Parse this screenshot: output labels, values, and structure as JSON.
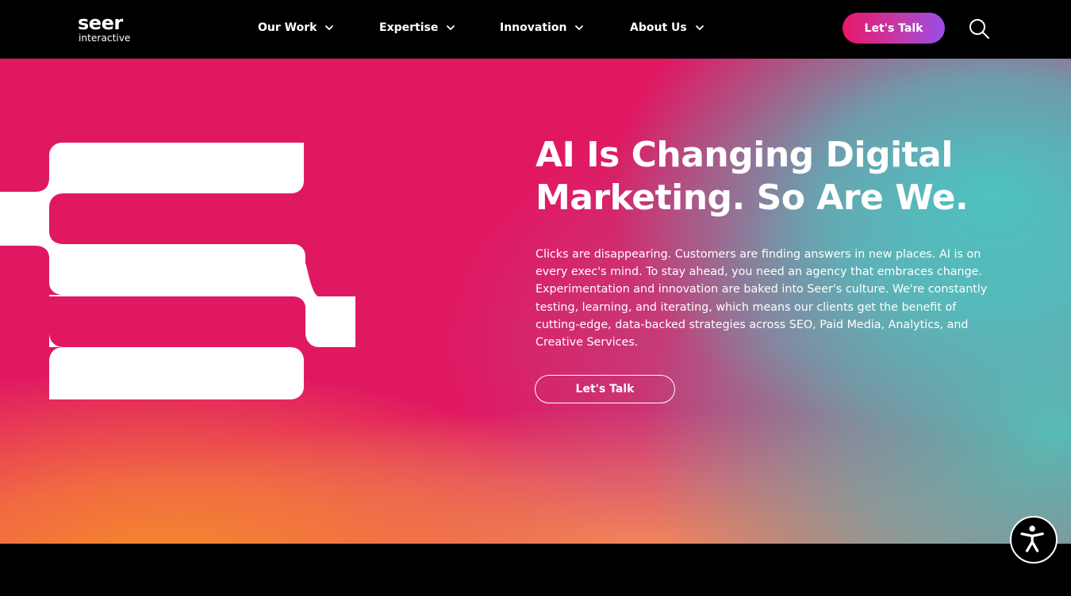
{
  "brand": {
    "wordmark": "seer",
    "subtitle": "interactive"
  },
  "nav": {
    "items": [
      {
        "label": "Our Work",
        "icon": "chevron-down-icon"
      },
      {
        "label": "Expertise",
        "icon": "chevron-down-icon"
      },
      {
        "label": "Innovation",
        "icon": "chevron-down-icon"
      },
      {
        "label": "About Us",
        "icon": "chevron-down-icon"
      }
    ],
    "cta_label": "Let's Talk",
    "search_icon": "search-icon"
  },
  "hero": {
    "headline_line1": "AI Is Changing Digital",
    "headline_line2": "Marketing. So Are We.",
    "body": "Clicks are disappearing. Customers are finding answers in new places. AI is on every exec's mind. To stay ahead, you need an agency that embraces change. Experimentation and innovation are baked into Seer's culture. We're constantly testing, learning, and iterating, which means our clients get the benefit of cutting-edge, data-backed strategies across SEO, Paid Media, Analytics, and Creative Services.",
    "cta_label": "Let's Talk",
    "emblem": "seer-emblem-icon"
  },
  "accessibility": {
    "icon": "accessibility-icon"
  },
  "colors": {
    "header_bg": "#000000",
    "hero_pink": "#e01862",
    "hero_teal": "#48c8c4",
    "hero_orange": "#f68c28",
    "cta_gradient_start": "#e8176a",
    "cta_gradient_end": "#9b4de8"
  }
}
